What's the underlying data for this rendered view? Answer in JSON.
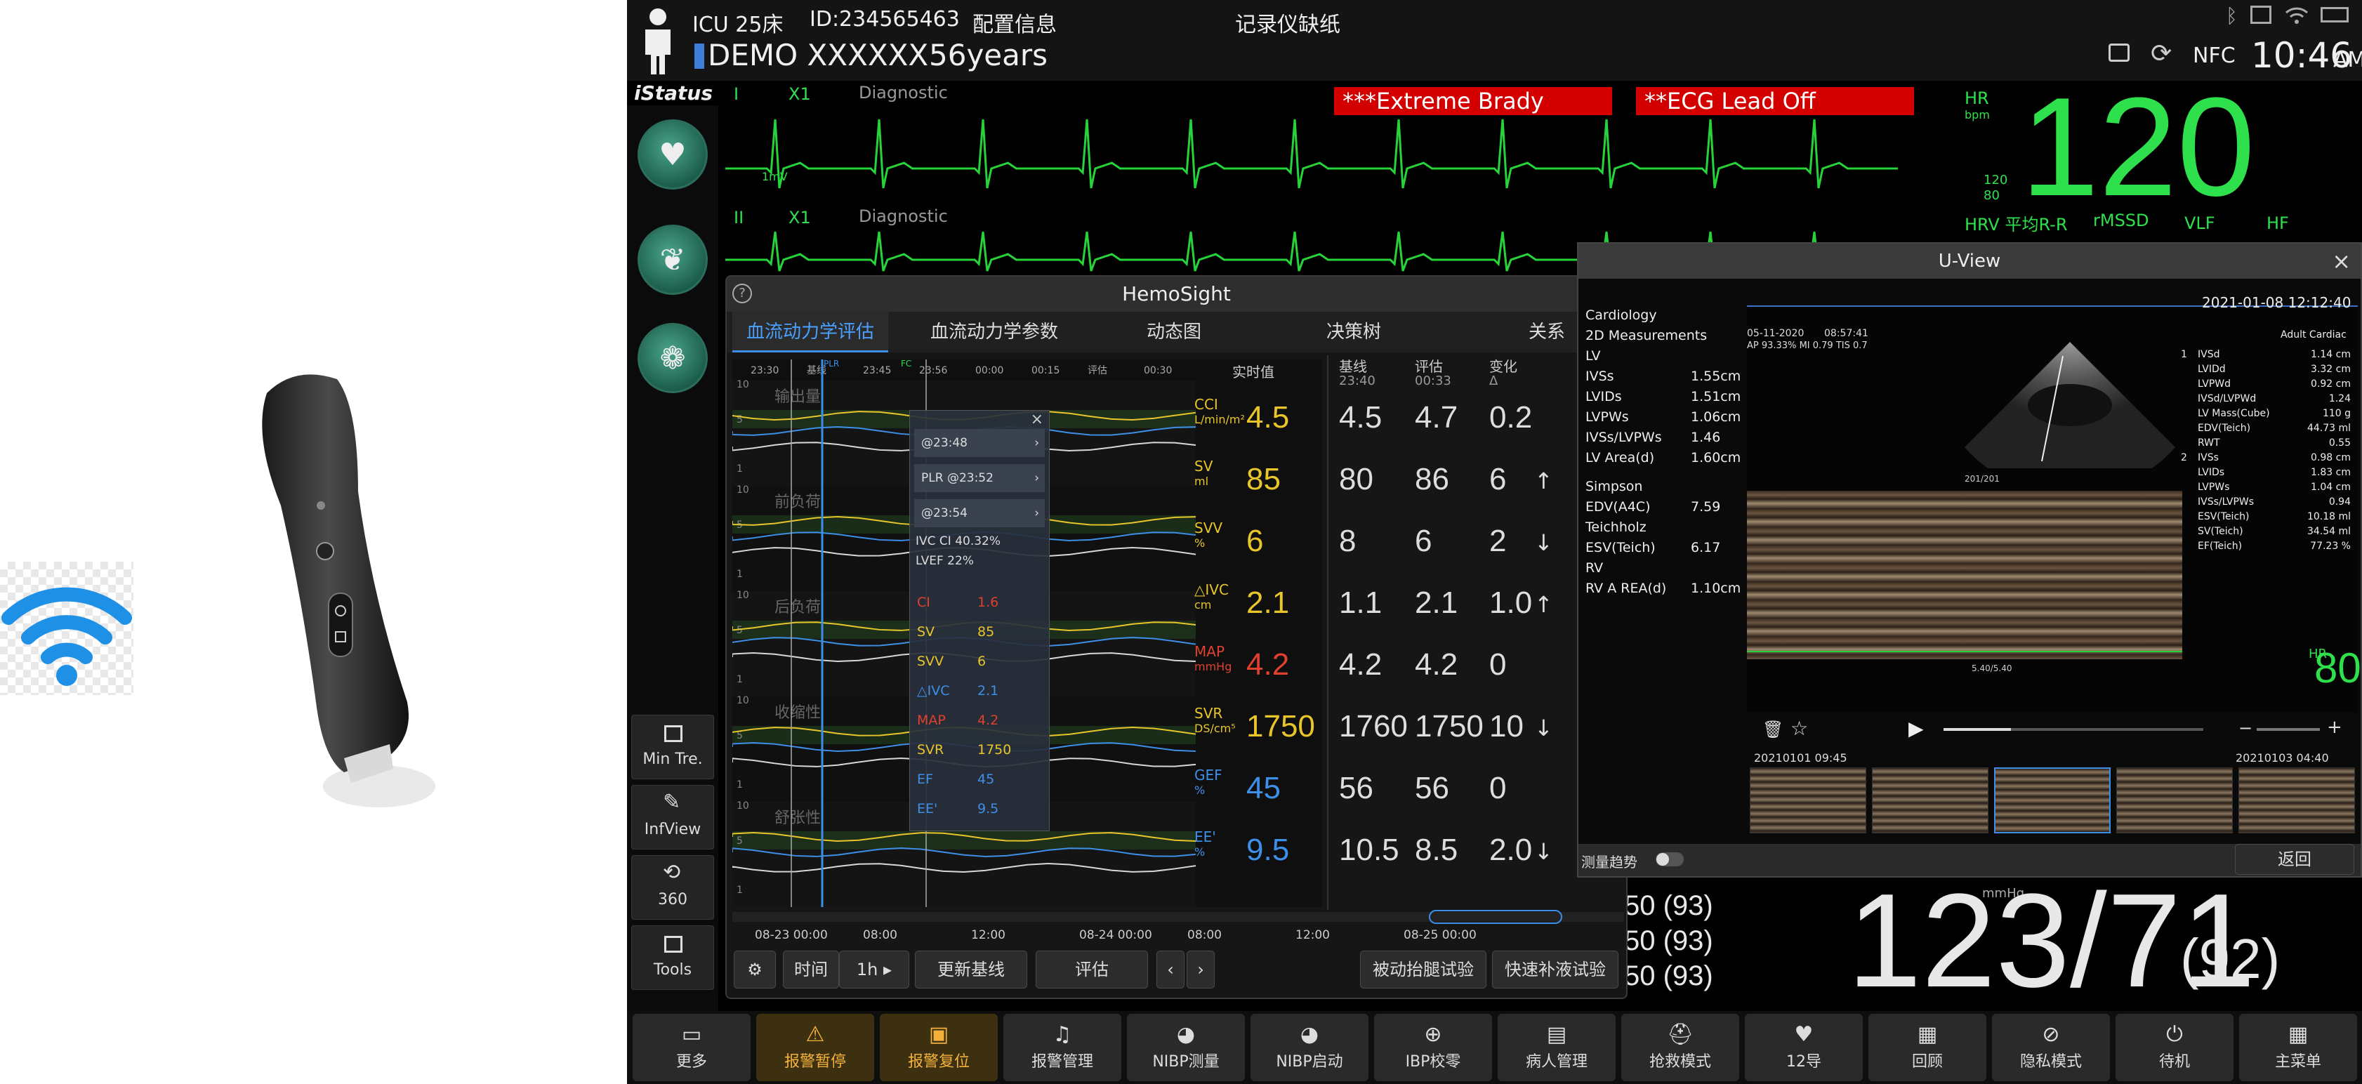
{
  "header": {
    "bed": "ICU 25床",
    "id": "ID:234565463",
    "config": "配置信息",
    "recorder": "记录仪缺纸",
    "patient": "DEMO XXXXXX",
    "age": "56years",
    "nfc": "NFC",
    "time": "10:46",
    "ampm": "AM"
  },
  "istatus": "iStatus",
  "alarms": [
    "***Extreme Brady",
    "**ECG Lead Off"
  ],
  "ecg": {
    "lead1": "I",
    "gain1": "X1",
    "mode1": "Diagnostic",
    "scale": "1mV",
    "lead2": "II",
    "gain2": "X1",
    "mode2": "Diagnostic"
  },
  "hr": {
    "label": "HR",
    "unit": "bpm",
    "value": "120",
    "upper": "120",
    "lower": "80",
    "hrv": "HRV 平均R-R",
    "rmssd": "rMSSD",
    "vlf": "VLF",
    "hf": "HF"
  },
  "left_buttons": [
    "Min Tre.",
    "InfView",
    "360",
    "Tools"
  ],
  "hemosight": {
    "title": "HemoSight",
    "tabs": [
      "血流动力学评估",
      "血流动力学参数",
      "动态图",
      "决策树",
      "关系"
    ],
    "time_axis": [
      "23:30",
      "基线",
      "23:45",
      "23:56",
      "00:00",
      "00:15",
      "评估",
      "00:30"
    ],
    "markers": [
      "PLR",
      "FC"
    ],
    "sections": [
      "输出量",
      "前负荷",
      "后负荷",
      "收缩性",
      "舒张性"
    ],
    "y_ticks": [
      "10",
      "5",
      "1"
    ],
    "popup": {
      "items": [
        "@23:48",
        "PLR @23:52",
        "@23:54"
      ],
      "ivc": "IVC CI 40.32%",
      "lvef": "LVEF 22%",
      "rows": [
        {
          "k": "CI",
          "v": "1.6",
          "c": "#e0402e"
        },
        {
          "k": "SV",
          "v": "85",
          "c": "#e8c62a"
        },
        {
          "k": "SVV",
          "v": "6",
          "c": "#e8c62a"
        },
        {
          "k": "△IVC",
          "v": "2.1",
          "c": "#3d8fe8"
        },
        {
          "k": "MAP",
          "v": "4.2",
          "c": "#e0402e"
        },
        {
          "k": "SVR",
          "v": "1750",
          "c": "#e8c62a"
        },
        {
          "k": "EF",
          "v": "45",
          "c": "#3d8fe8"
        },
        {
          "k": "EE'",
          "v": "9.5",
          "c": "#3d8fe8"
        }
      ]
    },
    "col_headers": {
      "realtime": "实时值",
      "baseline": "基线",
      "baseline_time": "23:40",
      "eval": "评估",
      "eval_time": "00:33",
      "change": "变化",
      "delta": "Δ"
    },
    "params": [
      {
        "name": "CCI",
        "unit": "L/min/m²",
        "value": "4.5",
        "color": "#e8c62a",
        "base": "4.5",
        "eval": "4.7",
        "change": "0.2",
        "arrow": ""
      },
      {
        "name": "SV",
        "unit": "ml",
        "value": "85",
        "color": "#e8c62a",
        "base": "80",
        "eval": "86",
        "change": "6",
        "arrow": "↑"
      },
      {
        "name": "SVV",
        "unit": "%",
        "value": "6",
        "color": "#e8c62a",
        "base": "8",
        "eval": "6",
        "change": "2",
        "arrow": "↓"
      },
      {
        "name": "△IVC",
        "unit": "cm",
        "value": "2.1",
        "color": "#e8c62a",
        "base": "1.1",
        "eval": "2.1",
        "change": "1.0",
        "arrow": "↑"
      },
      {
        "name": "MAP",
        "unit": "mmHg",
        "value": "4.2",
        "color": "#e0402e",
        "base": "4.2",
        "eval": "4.2",
        "change": "0",
        "arrow": ""
      },
      {
        "name": "SVR",
        "unit": "DS/cm⁵",
        "value": "1750",
        "color": "#e8c62a",
        "base": "1760",
        "eval": "1750",
        "change": "10",
        "arrow": "↓"
      },
      {
        "name": "GEF",
        "unit": "%",
        "value": "45",
        "color": "#3d8fe8",
        "base": "56",
        "eval": "56",
        "change": "0",
        "arrow": ""
      },
      {
        "name": "EE'",
        "unit": "%",
        "value": "9.5",
        "color": "#3d8fe8",
        "base": "10.5",
        "eval": "8.5",
        "change": "2.0",
        "arrow": "↓"
      }
    ],
    "overview_axis": [
      "08-23 00:00",
      "08:00",
      "12:00",
      "08-24 00:00",
      "08:00",
      "12:00",
      "08-25 00:00"
    ],
    "toolbar": {
      "time": "时间",
      "range": "1h",
      "update": "更新基线",
      "eval": "评估",
      "plr": "被动抬腿试验",
      "fluid": "快速补液试验"
    }
  },
  "uview": {
    "title": "U-View",
    "measurements": [
      "Cardiology",
      "2D Measurements",
      "LV"
    ],
    "lv": [
      {
        "k": "IVSs",
        "v": "1.55cm"
      },
      {
        "k": "LVIDs",
        "v": "1.51cm"
      },
      {
        "k": "LVPWs",
        "v": "1.06cm"
      },
      {
        "k": "IVSs/LVPWs",
        "v": "1.46"
      },
      {
        "k": "LV Area(d)",
        "v": "1.60cm"
      }
    ],
    "simpson": "Simpson",
    "simpson_rows": [
      {
        "k": "EDV(A4C)",
        "v": "7.59"
      }
    ],
    "teichholz": "Teichholz",
    "teich_rows": [
      {
        "k": "ESV(Teich)",
        "v": "6.17"
      }
    ],
    "rv": "RV",
    "rv_rows": [
      {
        "k": "RV A REA(d)",
        "v": "1.10cm"
      }
    ],
    "img_date": "05-11-2020",
    "img_time": "08:57:41",
    "img_info": "AP 93.33%  MI 0.79  TIS 0.7",
    "datetime": "2021-01-08  12:12:40",
    "preset": "Adult Cardiac",
    "ov_rows": [
      {
        "n": "1",
        "k": "IVSd",
        "v": "1.14 cm"
      },
      {
        "n": "",
        "k": "LVIDd",
        "v": "3.32 cm"
      },
      {
        "n": "",
        "k": "LVPWd",
        "v": "0.92 cm"
      },
      {
        "n": "",
        "k": "IVSd/LVPWd",
        "v": "1.24"
      },
      {
        "n": "",
        "k": "LV Mass(Cube)",
        "v": "110 g"
      },
      {
        "n": "",
        "k": "EDV(Teich)",
        "v": "44.73 ml"
      },
      {
        "n": "",
        "k": "RWT",
        "v": "0.55"
      },
      {
        "n": "2",
        "k": "IVSs",
        "v": "0.98 cm"
      },
      {
        "n": "",
        "k": "LVIDs",
        "v": "1.83 cm"
      },
      {
        "n": "",
        "k": "LVPWs",
        "v": "1.04 cm"
      },
      {
        "n": "",
        "k": "IVSs/LVPWs",
        "v": "0.94"
      },
      {
        "n": "",
        "k": "ESV(Teich)",
        "v": "10.18 ml"
      },
      {
        "n": "",
        "k": "SV(Teich)",
        "v": "34.54 ml"
      },
      {
        "n": "",
        "k": "EF(Teich)",
        "v": "77.23 %"
      }
    ],
    "frame": "201/201",
    "mmode_scale": "5.40/5.40",
    "hr_label": "HR",
    "hr_value": "80",
    "thumb_dates": [
      "20210101  09:45",
      "20210103  04:40"
    ],
    "trend_label": "测量趋势",
    "back": "返回"
  },
  "nibp": {
    "rows": [
      "50 (93)",
      "50 (93)",
      "50 (93)"
    ],
    "unit": "mmHg",
    "value": "123/71",
    "mean": "(92)"
  },
  "bottom_buttons": [
    {
      "label": "更多",
      "icon": "▭",
      "orange": false
    },
    {
      "label": "报警暂停",
      "icon": "⚠",
      "orange": true
    },
    {
      "label": "报警复位",
      "icon": "▣",
      "orange": true
    },
    {
      "label": "报警管理",
      "icon": "♫",
      "orange": false
    },
    {
      "label": "NIBP测量",
      "icon": "◕",
      "orange": false
    },
    {
      "label": "NIBP启动",
      "icon": "◕",
      "orange": false
    },
    {
      "label": "IBP校零",
      "icon": "⊕",
      "orange": false
    },
    {
      "label": "病人管理",
      "icon": "▤",
      "orange": false
    },
    {
      "label": "抢救模式",
      "icon": "⛑",
      "orange": false
    },
    {
      "label": "12导",
      "icon": "♥",
      "orange": false
    },
    {
      "label": "回顾",
      "icon": "▦",
      "orange": false
    },
    {
      "label": "隐私模式",
      "icon": "⊘",
      "orange": false
    },
    {
      "label": "待机",
      "icon": "⏻",
      "orange": false
    },
    {
      "label": "主菜单",
      "icon": "▦",
      "orange": false
    }
  ]
}
